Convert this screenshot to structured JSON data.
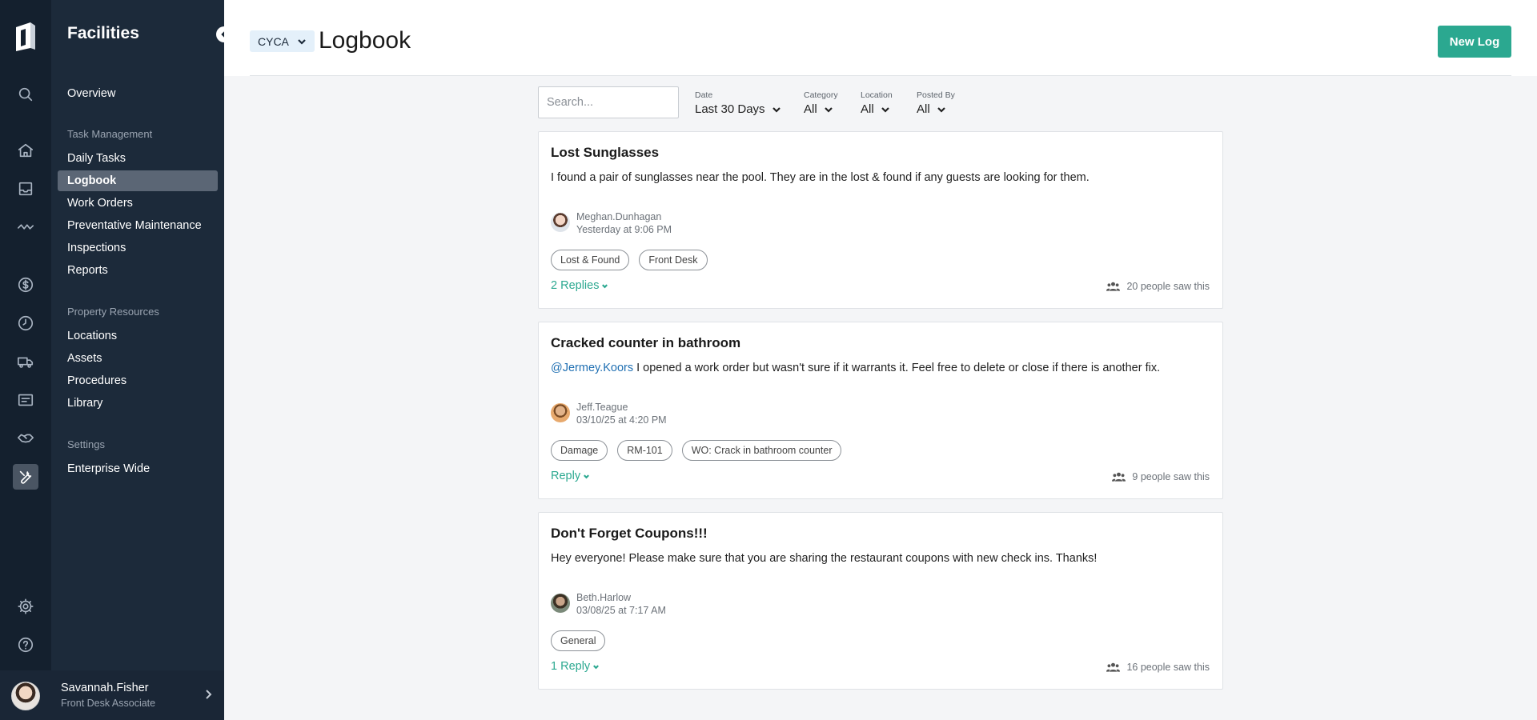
{
  "app": {
    "section": "Facilities",
    "user_name": "Savannah.Fisher",
    "user_role": "Front Desk Associate"
  },
  "nav": {
    "overview": "Overview",
    "task_management": {
      "heading": "Task Management",
      "items": [
        "Daily Tasks",
        "Logbook",
        "Work Orders",
        "Preventative Maintenance",
        "Inspections",
        "Reports"
      ]
    },
    "property_resources": {
      "heading": "Property Resources",
      "items": [
        "Locations",
        "Assets",
        "Procedures",
        "Library"
      ]
    },
    "settings": {
      "heading": "Settings",
      "items": [
        "Enterprise Wide"
      ]
    },
    "active": "Logbook"
  },
  "header": {
    "property": "CYCA",
    "title": "Logbook",
    "new_log_label": "New Log"
  },
  "filters": {
    "search_placeholder": "Search...",
    "date": {
      "label": "Date",
      "value": "Last 30 Days"
    },
    "category": {
      "label": "Category",
      "value": "All"
    },
    "location": {
      "label": "Location",
      "value": "All"
    },
    "posted_by": {
      "label": "Posted By",
      "value": "All"
    }
  },
  "logs": [
    {
      "title": "Lost Sunglasses",
      "mention": "",
      "body": "I found a pair of sunglasses near the pool. They are in the lost & found if any guests are looking for them.",
      "author": "Meghan.Dunhagan",
      "posted": "Yesterday at 9:06 PM",
      "tags": [
        "Lost & Found",
        "Front Desk"
      ],
      "replies": "2 Replies",
      "seen": "20 people saw this"
    },
    {
      "title": "Cracked counter in bathroom",
      "mention": "@Jermey.Koors",
      "body": " I opened a work order but wasn't sure if it warrants it. Feel free to delete or close if there is another fix.",
      "author": "Jeff.Teague",
      "posted": "03/10/25 at 4:20 PM",
      "tags": [
        "Damage",
        "RM-101",
        "WO: Crack in bathroom counter"
      ],
      "replies": "Reply",
      "seen": "9 people saw this"
    },
    {
      "title": "Don't Forget Coupons!!!",
      "mention": "",
      "body": "Hey everyone! Please make sure that you are sharing the restaurant coupons with new check ins. Thanks!",
      "author": "Beth.Harlow",
      "posted": "03/08/25 at 7:17 AM",
      "tags": [
        "General"
      ],
      "replies": "1 Reply",
      "seen": "16 people saw this"
    }
  ],
  "colors": {
    "rail": "#14202e",
    "nav": "#1c2a3a",
    "accent": "#2ba890",
    "mention": "#1f6fb2"
  },
  "icons": [
    "logo-icon",
    "search-icon",
    "home-icon",
    "inbox-icon",
    "activity-icon",
    "dollar-icon",
    "clock-icon",
    "truck-icon",
    "id-card-icon",
    "handshake-icon",
    "wrench-icon",
    "gear-icon",
    "help-icon"
  ]
}
